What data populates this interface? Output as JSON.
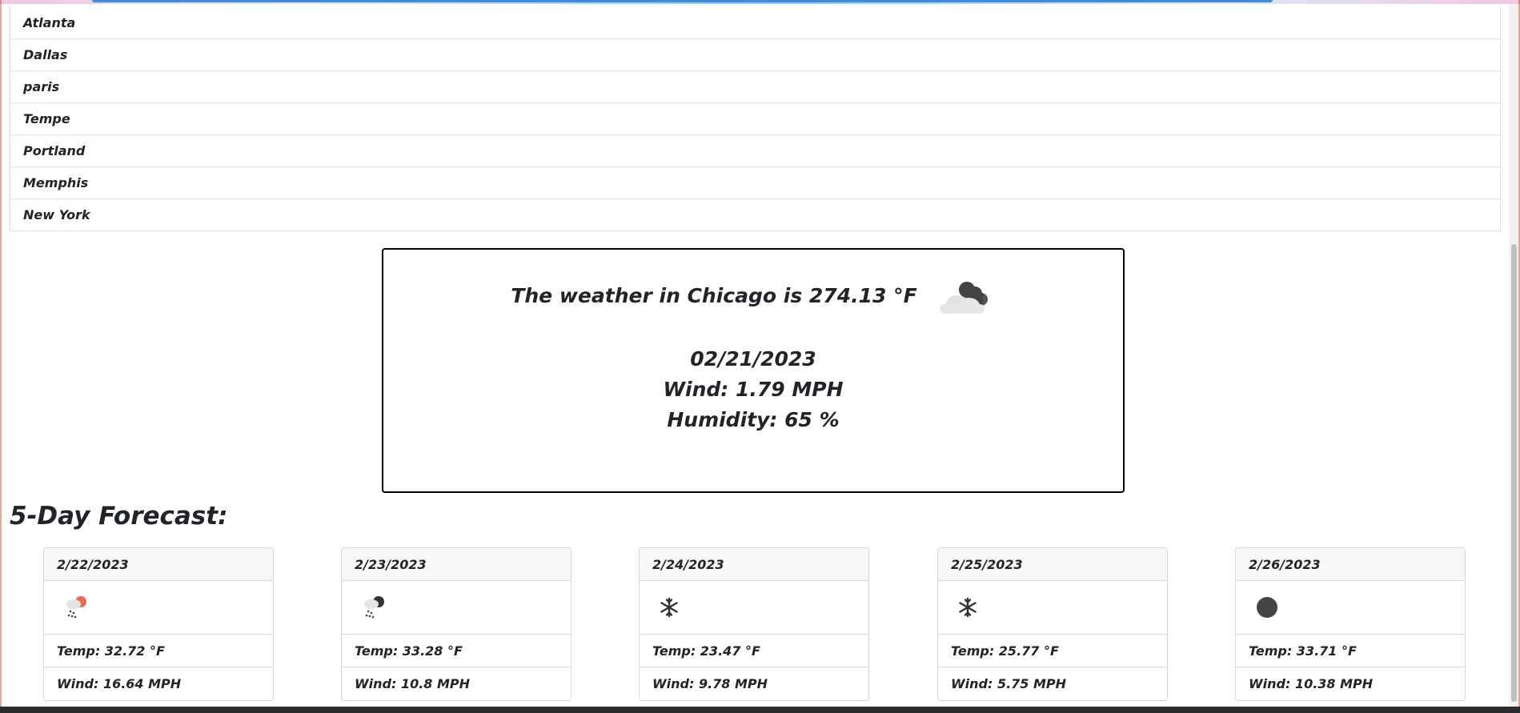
{
  "search_history": [
    "Atlanta",
    "Dallas",
    "paris",
    "Tempe",
    "Portland",
    "Memphis",
    "New York"
  ],
  "current": {
    "title": "The weather in Chicago is 274.13 °F",
    "icon": "broken-clouds-icon",
    "date": "02/21/2023",
    "wind": "Wind: 1.79 MPH",
    "humidity": "Humidity: 65 %"
  },
  "forecast_heading": "5-Day Forecast:",
  "forecast": [
    {
      "date": "2/22/2023",
      "icon": "rain-snow-day-icon",
      "temp": "Temp: 32.72 °F",
      "wind": "Wind: 16.64 MPH"
    },
    {
      "date": "2/23/2023",
      "icon": "rain-snow-night-icon",
      "temp": "Temp: 33.28 °F",
      "wind": "Wind: 10.8 MPH"
    },
    {
      "date": "2/24/2023",
      "icon": "snowflake-icon",
      "temp": "Temp: 23.47 °F",
      "wind": "Wind: 9.78 MPH"
    },
    {
      "date": "2/25/2023",
      "icon": "snowflake-icon",
      "temp": "Temp: 25.77 °F",
      "wind": "Wind: 5.75 MPH"
    },
    {
      "date": "2/26/2023",
      "icon": "moon-icon",
      "temp": "Temp: 33.71 °F",
      "wind": "Wind: 10.38 MPH"
    }
  ]
}
